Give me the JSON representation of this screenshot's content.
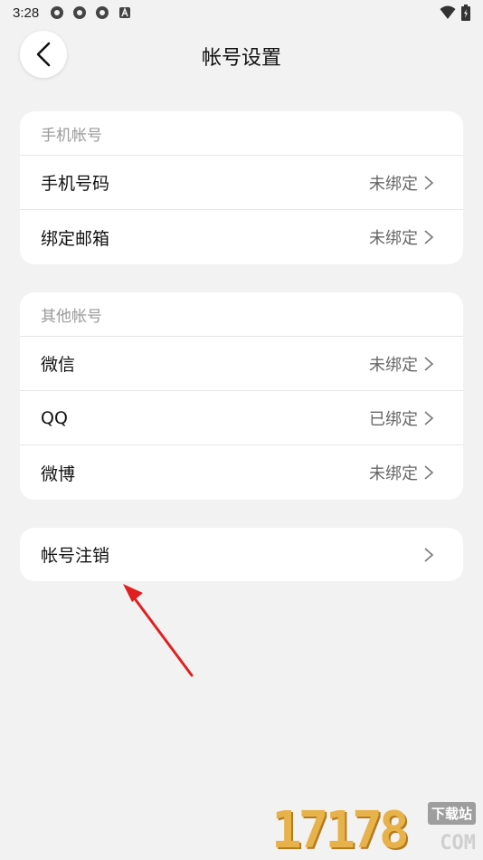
{
  "status_bar": {
    "time": "3:28",
    "icons": [
      "notification-icon-1",
      "notification-icon-2",
      "notification-icon-3",
      "app-a-icon"
    ],
    "right_icons": [
      "wifi-icon",
      "battery-icon"
    ]
  },
  "header": {
    "title": "帐号设置",
    "back_icon": "chevron-left-icon"
  },
  "phone_section": {
    "title": "手机帐号",
    "items": [
      {
        "label": "手机号码",
        "value": "未绑定"
      },
      {
        "label": "绑定邮箱",
        "value": "未绑定"
      }
    ]
  },
  "other_section": {
    "title": "其他帐号",
    "items": [
      {
        "label": "微信",
        "value": "未绑定"
      },
      {
        "label": "QQ",
        "value": "已绑定"
      },
      {
        "label": "微博",
        "value": "未绑定"
      }
    ]
  },
  "cancel_account": {
    "label": "帐号注销"
  },
  "annotation": {
    "color": "#e02020"
  },
  "watermark": {
    "digits": "17178",
    "tag": "下载站",
    "suffix": "COM"
  }
}
